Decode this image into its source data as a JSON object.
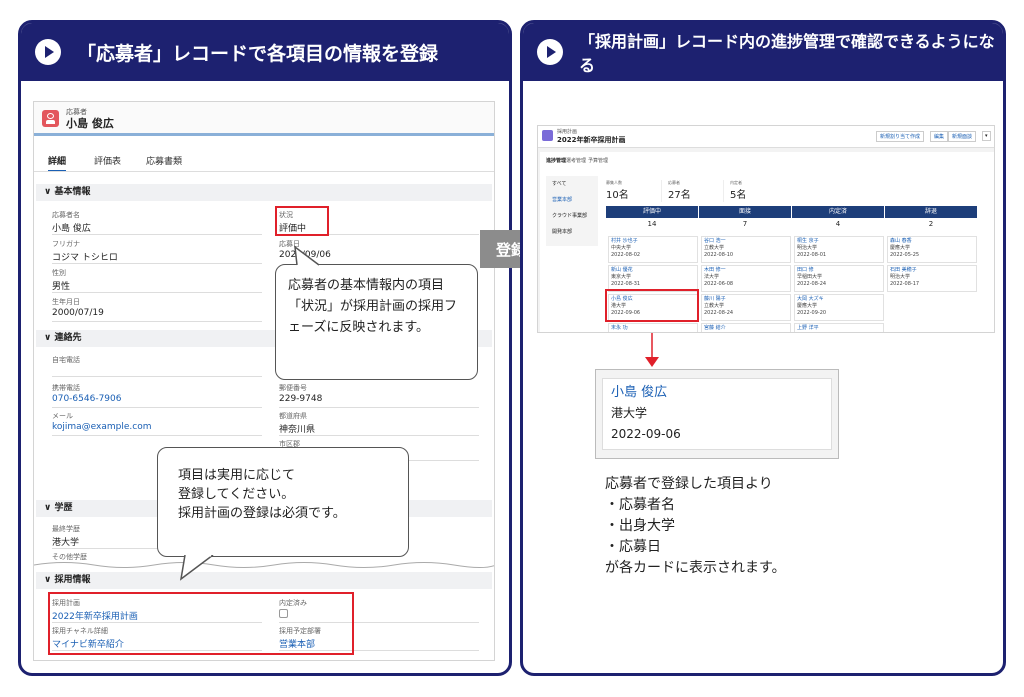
{
  "left_panel": {
    "title": "「応募者」レコードで各項目の情報を登録",
    "record": {
      "type_label": "応募者",
      "name": "小島 俊広",
      "tabs": [
        "詳細",
        "評価表",
        "応募書類"
      ],
      "basic_section": "基本情報",
      "applicant_name_label": "応募者名",
      "applicant_name": "小島 俊広",
      "status_label": "状況",
      "status": "評価中",
      "furigana_label": "フリガナ",
      "furigana": "コジマ トシヒロ",
      "apply_date_label": "応募日",
      "apply_date": "2022/09/06",
      "gender_label": "性別",
      "gender": "男性",
      "birthday_label": "生年月日",
      "birthday": "2000/07/19",
      "contact_section": "連絡先",
      "home_phone_label": "自宅電話",
      "mobile_label": "携帯電話",
      "mobile": "070-6546-7906",
      "postal_label": "郵便番号",
      "postal": "229-9748",
      "email_label": "メール",
      "email": "kojima@example.com",
      "prefecture_label": "都道府県",
      "prefecture": "神奈川県",
      "city_label": "市区郡",
      "education_section": "学歴",
      "school_label": "最終学歴",
      "school": "港大学",
      "other_school_label": "その他学歴",
      "hiring_section": "採用情報",
      "plan_label": "採用計画",
      "plan": "2022年新卒採用計画",
      "offer_label": "内定済み",
      "channel_label": "採用チャネル詳細",
      "channel": "マイナビ新卒紹介",
      "dept_label": "採用予定部署",
      "dept": "営業本部"
    },
    "bubble1": "応募者の基本情報内の項目「状況」が採用計画の採用フェーズに反映されます。",
    "bubble2_lines": [
      "項目は実用に応じて",
      "登録してください。",
      "採用計画の登録は必須です。"
    ]
  },
  "arrow_label": "登録",
  "right_panel": {
    "title": "「採用計画」レコード内の進捗管理で確認できるようになる",
    "record": {
      "type_label": "採用計画",
      "name": "2022年新卒採用計画",
      "buttons": [
        "新規割り当て作成",
        "編集",
        "新規面談"
      ],
      "tabs": [
        "進捗管理",
        "選考管理",
        "予算管理"
      ],
      "side_items": [
        "すべて",
        "営業本部",
        "クラウド事業部",
        "開発本部"
      ],
      "stats": [
        {
          "label": "募集人数",
          "value": "10名"
        },
        {
          "label": "応募者",
          "value": "27名"
        },
        {
          "label": "内定者",
          "value": "5名"
        }
      ],
      "stages": [
        {
          "name": "評価中",
          "count": "14"
        },
        {
          "name": "面接",
          "count": "7"
        },
        {
          "name": "内定済",
          "count": "4"
        },
        {
          "name": "辞退",
          "count": "2"
        }
      ],
      "cards": [
        [
          "村井 沙也子",
          "中央大学",
          "2022-08-02"
        ],
        [
          "谷口 浩一",
          "立教大学",
          "2022-08-10"
        ],
        [
          "桐生 京子",
          "明治大学",
          "2022-08-01"
        ],
        [
          "森山 春香",
          "慶應大学",
          "2022-05-25"
        ],
        [
          "新山 優花",
          "東京大学",
          "2022-08-31"
        ],
        [
          "木田 修一",
          "法大学",
          "2022-06-08"
        ],
        [
          "田口 修",
          "早稲田大学",
          "2022-08-24"
        ],
        [
          "石田 美穂子",
          "明治大学",
          "2022-08-17"
        ],
        [
          "小島 俊広",
          "港大学",
          "2022-09-06"
        ],
        [
          "藤川 陽子",
          "立教大学",
          "2022-08-24"
        ],
        [
          "大岡 大ズキ",
          "慶應大学",
          "2022-09-20"
        ],
        [
          "末永 功",
          "",
          ""
        ],
        [
          "宮藤 結介",
          "",
          ""
        ],
        [
          "上野 洋平",
          "",
          ""
        ]
      ]
    },
    "zoom_card": {
      "name": "小島 俊広",
      "school": "港大学",
      "date": "2022-09-06"
    },
    "note_title": "応募者で登録した項目より",
    "note_items": [
      "・応募者名",
      "・出身大学",
      "・応募日"
    ],
    "note_footer": "が各カードに表示されます。"
  },
  "colors": {
    "navy": "#1d2170",
    "accent_red": "#e0202a",
    "link": "#1a5fb4",
    "stage_bar": "#1d3e7a"
  }
}
